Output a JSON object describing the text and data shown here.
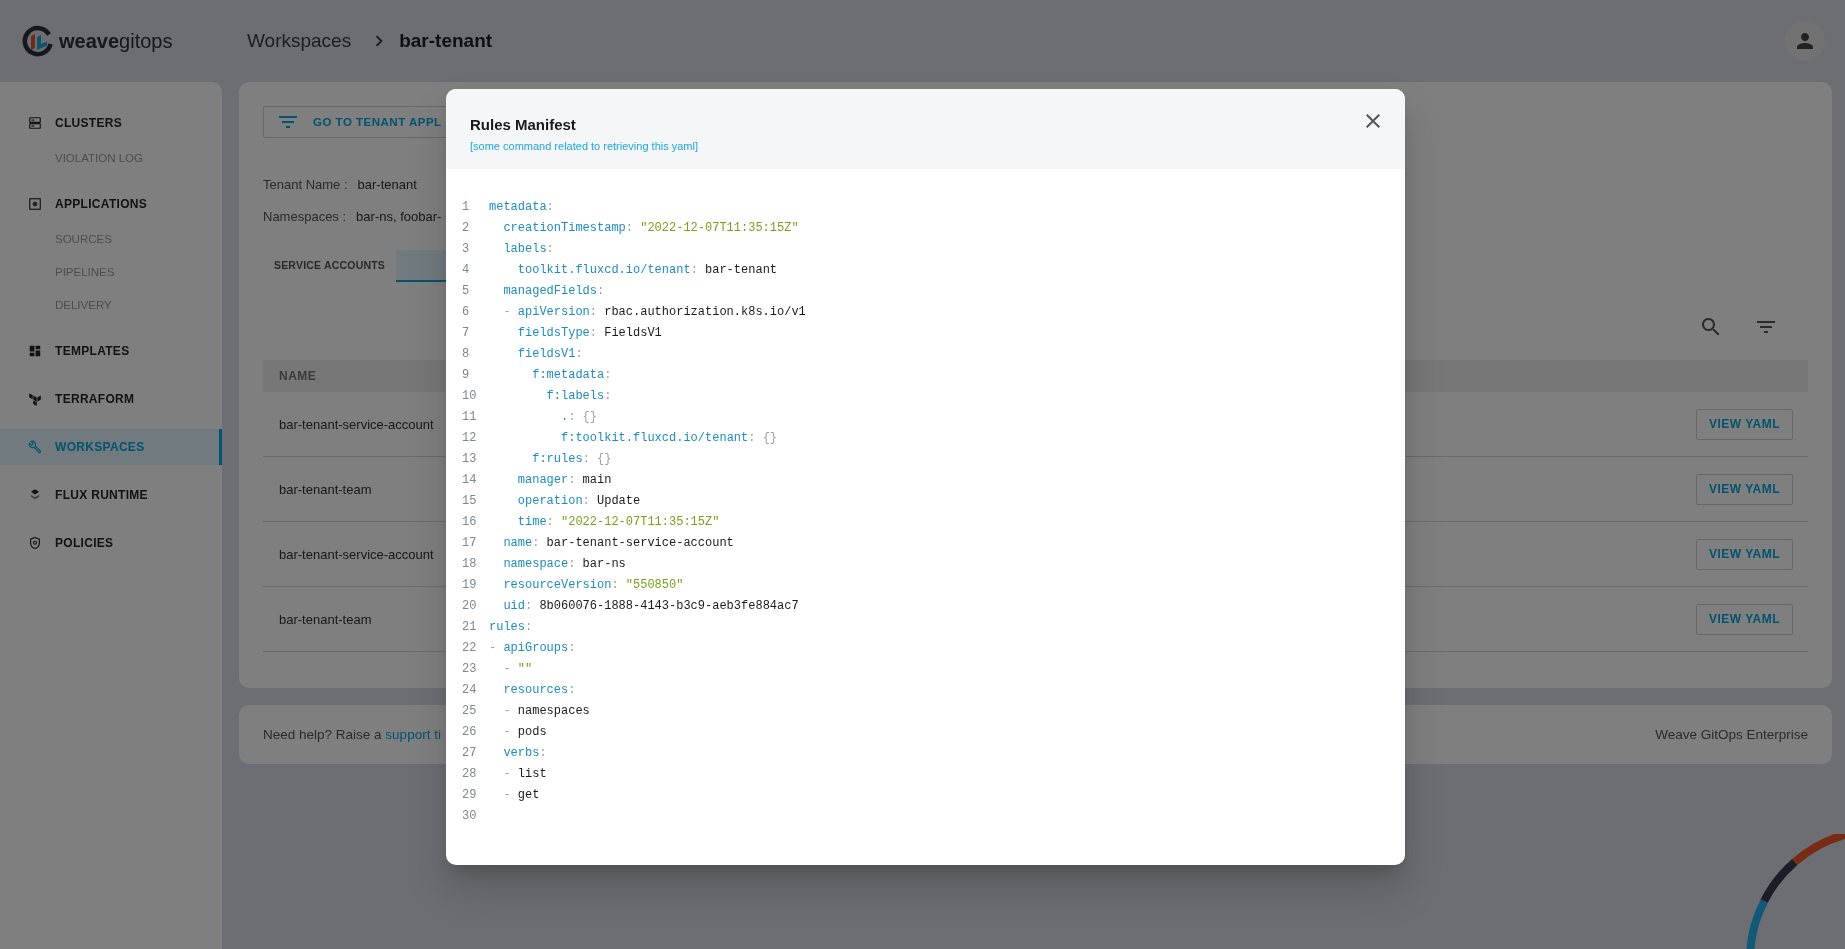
{
  "header": {
    "logo": "**weave**gitops",
    "breadcrumb": [
      {
        "label": "Workspaces",
        "current": false
      },
      {
        "label": "bar-tenant",
        "current": true
      }
    ]
  },
  "sidebar": {
    "items": [
      {
        "label": "CLUSTERS",
        "selected": false,
        "children": [
          {
            "label": "VIOLATION LOG",
            "selected": false
          }
        ]
      },
      {
        "label": "APPLICATIONS",
        "selected": false,
        "children": [
          {
            "label": "SOURCES",
            "selected": false
          },
          {
            "label": "PIPELINES",
            "selected": false
          },
          {
            "label": "DELIVERY",
            "selected": false
          }
        ]
      },
      {
        "label": "TEMPLATES",
        "selected": false
      },
      {
        "label": "TERRAFORM",
        "selected": false
      },
      {
        "label": "WORKSPACES",
        "selected": true
      },
      {
        "label": "FLUX RUNTIME",
        "selected": false
      },
      {
        "label": "POLICIES",
        "selected": false
      }
    ]
  },
  "tenant": {
    "button": "GO TO TENANT APPL",
    "details": [
      {
        "label": "Tenant Name :",
        "value": "bar-tenant"
      },
      {
        "label": "Namespaces :",
        "value": "bar-ns, foobar-"
      }
    ]
  },
  "tabs": [
    {
      "label": "SERVICE ACCOUNTS",
      "selected": false
    },
    {
      "selected": true
    }
  ],
  "table": {
    "columns": [
      "NAME"
    ],
    "rows": [
      {
        "name": "bar-tenant-service-account",
        "action": "VIEW YAML"
      },
      {
        "name": "bar-tenant-team",
        "action": "VIEW YAML"
      },
      {
        "name": "bar-tenant-service-account",
        "action": "VIEW YAML"
      },
      {
        "name": "bar-tenant-team",
        "action": "VIEW YAML"
      }
    ]
  },
  "footer": {
    "help": "Need help? Raise a",
    "link": "support ti",
    "brand": "Weave GitOps Enterprise"
  },
  "modal": {
    "title": "Rules Manifest",
    "subtitle": "[some command related to retrieving this yaml]",
    "lines": [
      {
        "number": "1",
        "tokens": [
          {
            "kind": "key",
            "text": "metadata"
          },
          {
            "kind": "punct",
            "text": ":"
          }
        ],
        "children": [
          {
            "number": "2",
            "tokens": [
              {
                "kind": "key",
                "text": "creationTimestamp"
              },
              {
                "kind": "punct",
                "text": ":"
              },
              {
                "kind": "string",
                "text": "\"2022-12-07T11:35:15Z\""
              }
            ]
          },
          {
            "number": "3",
            "tokens": [
              {
                "kind": "key",
                "text": "labels"
              },
              {
                "kind": "punct",
                "text": ":"
              }
            ],
            "children": [
              {
                "number": "4",
                "tokens": [
                  {
                    "kind": "key",
                    "text": "toolkit.fluxcd.io/tenant"
                  },
                  {
                    "kind": "punct",
                    "text": ":"
                  },
                  {
                    "kind": "value",
                    "text": "bar-tenant"
                  }
                ]
              }
            ]
          },
          {
            "number": "5",
            "tokens": [
              {
                "kind": "key",
                "text": "managedFields"
              },
              {
                "kind": "punct",
                "text": ":"
              }
            ],
            "children": [
              {
                "number": "6",
                "tokens": [
                  {
                    "kind": "dash",
                    "text": "-"
                  },
                  {
                    "kind": "key",
                    "text": "apiVersion"
                  },
                  {
                    "kind": "punct",
                    "text": ":"
                  },
                  {
                    "kind": "value",
                    "text": "rbac.authorization.k8s.io/v1"
                  }
                ]
              },
              {
                "number": "7",
                "tokens": [
                  {
                    "kind": "key",
                    "text": "fieldsType"
                  },
                  {
                    "kind": "punct",
                    "text": ":"
                  },
                  {
                    "kind": "value",
                    "text": "FieldsV1"
                  }
                ]
              },
              {
                "number": "8",
                "tokens": [
                  {
                    "kind": "key",
                    "text": "fieldsV1"
                  },
                  {
                    "kind": "punct",
                    "text": ":"
                  }
                ],
                "children": [
                  {
                    "number": "9",
                    "tokens": [
                      {
                        "kind": "key",
                        "text": "f:metadata"
                      },
                      {
                        "kind": "punct",
                        "text": ":"
                      }
                    ],
                    "children": [
                      {
                        "number": "10",
                        "tokens": [
                          {
                            "kind": "key",
                            "text": "f:labels"
                          },
                          {
                            "kind": "punct",
                            "text": ":"
                          }
                        ],
                        "children": [
                          {
                            "number": "11",
                            "tokens": [
                              {
                                "kind": "key",
                                "text": "."
                              },
                              {
                                "kind": "punct",
                                "text": ":"
                              },
                              {
                                "kind": "punct",
                                "text": "{}"
                              }
                            ]
                          },
                          {
                            "number": "12",
                            "tokens": [
                              {
                                "kind": "key",
                                "text": "f:toolkit.fluxcd.io/tenant"
                              },
                              {
                                "kind": "punct",
                                "text": ":"
                              },
                              {
                                "kind": "punct",
                                "text": "{}"
                              }
                            ]
                          }
                        ]
                      }
                    ]
                  },
                  {
                    "number": "13",
                    "tokens": [
                      {
                        "kind": "key",
                        "text": "f:rules"
                      },
                      {
                        "kind": "punct",
                        "text": ":"
                      },
                      {
                        "kind": "punct",
                        "text": "{}"
                      }
                    ]
                  }
                ]
              },
              {
                "number": "14",
                "tokens": [
                  {
                    "kind": "key",
                    "text": "manager"
                  },
                  {
                    "kind": "punct",
                    "text": ":"
                  },
                  {
                    "kind": "value",
                    "text": "main"
                  }
                ]
              },
              {
                "number": "15",
                "tokens": [
                  {
                    "kind": "key",
                    "text": "operation"
                  },
                  {
                    "kind": "punct",
                    "text": ":"
                  },
                  {
                    "kind": "value",
                    "text": "Update"
                  }
                ]
              },
              {
                "number": "16",
                "tokens": [
                  {
                    "kind": "key",
                    "text": "time"
                  },
                  {
                    "kind": "punct",
                    "text": ":"
                  },
                  {
                    "kind": "string",
                    "text": "\"2022-12-07T11:35:15Z\""
                  }
                ]
              }
            ]
          },
          {
            "number": "17",
            "tokens": [
              {
                "kind": "key",
                "text": "name"
              },
              {
                "kind": "punct",
                "text": ":"
              },
              {
                "kind": "value",
                "text": "bar-tenant-service-account"
              }
            ]
          },
          {
            "number": "18",
            "tokens": [
              {
                "kind": "key",
                "text": "namespace"
              },
              {
                "kind": "punct",
                "text": ":"
              },
              {
                "kind": "value",
                "text": "bar-ns"
              }
            ]
          },
          {
            "number": "19",
            "tokens": [
              {
                "kind": "key",
                "text": "resourceVersion"
              },
              {
                "kind": "punct",
                "text": ":"
              },
              {
                "kind": "string",
                "text": "\"550850\""
              }
            ]
          },
          {
            "number": "20",
            "tokens": [
              {
                "kind": "key",
                "text": "uid"
              },
              {
                "kind": "punct",
                "text": ":"
              },
              {
                "kind": "value",
                "text": "8b060076-1888-4143-b3c9-aeb3fe884ac7"
              }
            ]
          }
        ]
      },
      {
        "number": "21",
        "tokens": [
          {
            "kind": "key",
            "text": "rules"
          },
          {
            "kind": "punct",
            "text": ":"
          }
        ],
        "children": [
          {
            "number": "22",
            "tokens": [
              {
                "kind": "dash",
                "text": "-"
              },
              {
                "kind": "key",
                "text": "apiGroups"
              },
              {
                "kind": "punct",
                "text": ":"
              }
            ],
            "children": [
              {
                "number": "23",
                "tokens": [
                  {
                    "kind": "dash",
                    "text": "-"
                  },
                  {
                    "kind": "string",
                    "text": "\"\""
                  }
                ]
              }
            ]
          },
          {
            "number": "24",
            "tokens": [
              {
                "kind": "key",
                "text": "resources"
              },
              {
                "kind": "punct",
                "text": ":"
              }
            ],
            "children": [
              {
                "number": "25",
                "tokens": [
                  {
                    "kind": "dash",
                    "text": "-"
                  },
                  {
                    "kind": "value",
                    "text": "namespaces"
                  }
                ]
              },
              {
                "number": "26",
                "tokens": [
                  {
                    "kind": "dash",
                    "text": "-"
                  },
                  {
                    "kind": "value",
                    "text": "pods"
                  }
                ]
              }
            ]
          },
          {
            "number": "27",
            "tokens": [
              {
                "kind": "key",
                "text": "verbs"
              },
              {
                "kind": "punct",
                "text": ":"
              }
            ],
            "children": [
              {
                "number": "28",
                "tokens": [
                  {
                    "kind": "dash",
                    "text": "-"
                  },
                  {
                    "kind": "value",
                    "text": "list"
                  }
                ]
              },
              {
                "number": "29",
                "tokens": [
                  {
                    "kind": "dash",
                    "text": "-"
                  },
                  {
                    "kind": "value",
                    "text": "get"
                  }
                ]
              }
            ]
          }
        ]
      },
      {
        "number": "30"
      }
    ]
  }
}
